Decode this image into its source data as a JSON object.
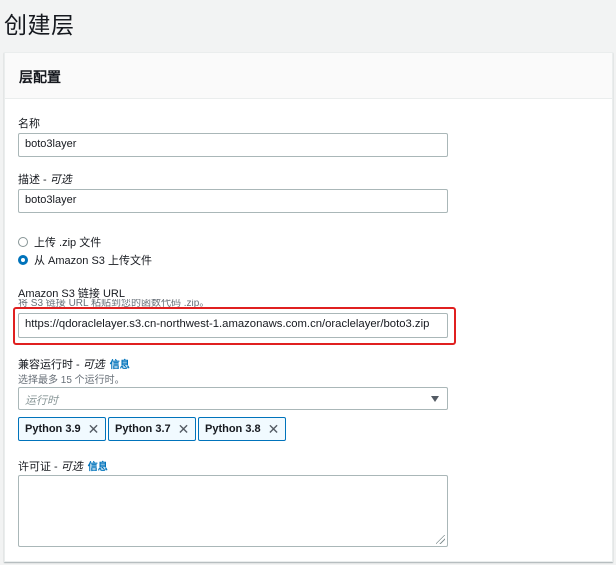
{
  "page": {
    "title": "创建层"
  },
  "panel": {
    "title": "层配置"
  },
  "fields": {
    "name": {
      "label": "名称",
      "value": "boto3layer"
    },
    "description": {
      "label_main": "描述 - ",
      "label_optional": "可选",
      "value": "boto3layer"
    },
    "upload": {
      "options": [
        {
          "label": "上传 .zip 文件",
          "checked": false
        },
        {
          "label": "从 Amazon S3 上传文件",
          "checked": true
        }
      ]
    },
    "s3_url": {
      "label": "Amazon S3 链接 URL",
      "hint": "将 S3 链接 URL 粘贴到您的函数代码 .zip。",
      "value": "https://qdoraclelayer.s3.cn-northwest-1.amazonaws.com.cn/oraclelayer/boto3.zip"
    },
    "runtimes": {
      "label_main": "兼容运行时 - ",
      "label_optional": "可选",
      "info": "信息",
      "hint": "选择最多 15 个运行时。",
      "placeholder": "运行时",
      "tokens": [
        "Python 3.9",
        "Python 3.7",
        "Python 3.8"
      ]
    },
    "license": {
      "label_main": "许可证 - ",
      "label_optional": "可选",
      "info": "信息",
      "value": ""
    }
  },
  "colors": {
    "accent": "#0073bb",
    "highlight": "#e02020"
  }
}
